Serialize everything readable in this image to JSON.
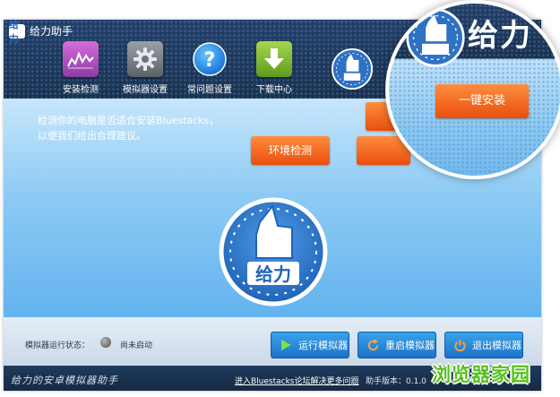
{
  "app": {
    "logo_text": "给力",
    "title": "给力助手"
  },
  "toolbar": [
    {
      "label": "安装检测",
      "icon": "equalizer-icon"
    },
    {
      "label": "模拟器设置",
      "icon": "gear-icon"
    },
    {
      "label": "常问题设置",
      "icon": "question-icon"
    },
    {
      "label": "下载中心",
      "icon": "download-icon"
    }
  ],
  "main": {
    "intro_line1": "检测你的电脑是否适合安装Bluestacks，",
    "intro_line2": "以便我们给出合理建议。",
    "env_check_label": "环境检测",
    "emblem_text": "给力"
  },
  "magnifier": {
    "brand_text": "给力",
    "one_click_install_label": "一键安装"
  },
  "bottom": {
    "status_label": "模拟器运行状态：",
    "status_value": "尚未启动",
    "run_label": "运行模拟器",
    "restart_label": "重启模拟器",
    "exit_label": "退出模拟器"
  },
  "footer": {
    "slogan": "给力的安卓模拟器助手",
    "forum_link": "进入Bluestacks论坛解决更多问题",
    "version": "助手版本：0.1.0"
  },
  "watermark": {
    "text": "浏览器家园"
  },
  "colors": {
    "title_bg": "#1a3150",
    "main_bg": "#8ccaf4",
    "orange_button": "#e94f0c",
    "blue_button": "#1c73c8",
    "watermark": "#55c21e"
  }
}
